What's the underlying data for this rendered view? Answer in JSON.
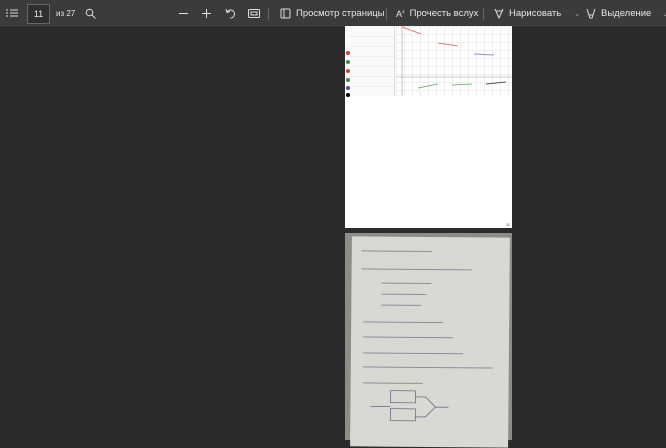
{
  "toolbar": {
    "current_page": "11",
    "total_pages": "из 27",
    "page_view": "Просмотр страницы",
    "read_aloud": "Прочесть вслух",
    "draw": "Нарисовать",
    "highlight": "Выделение"
  },
  "page1": {
    "page_number": "11"
  }
}
